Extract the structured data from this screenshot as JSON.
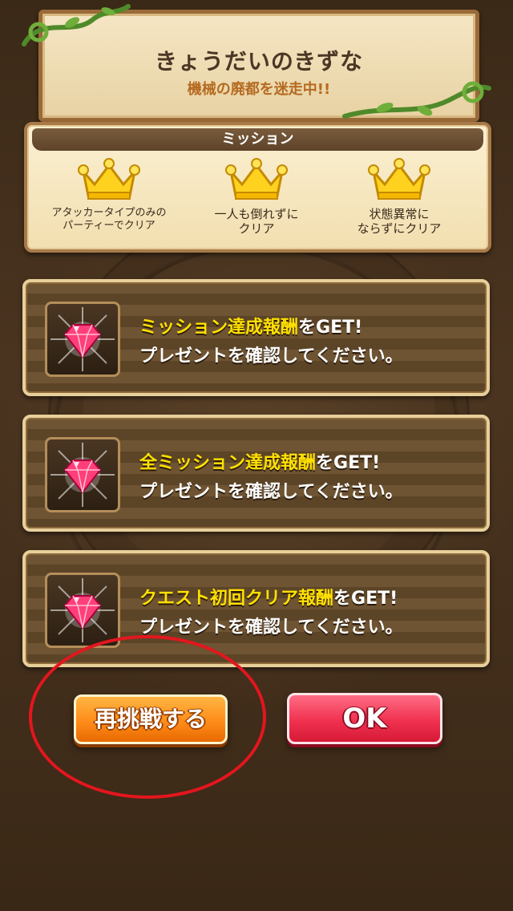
{
  "title_panel": {
    "title": "きょうだいのきずな",
    "subtitle": "機械の廃都を迷走中!!"
  },
  "mission_panel": {
    "header": "ミッション",
    "items": [
      {
        "label": "アタッカータイプのみの\nパーティーでクリア",
        "icon": "crown-icon"
      },
      {
        "label": "一人も倒れずに\nクリア",
        "icon": "crown-icon"
      },
      {
        "label": "状態異常に\nならずにクリア",
        "icon": "crown-icon"
      }
    ]
  },
  "rewards": [
    {
      "highlight": "ミッション達成報酬",
      "suffix": "をGET!",
      "line2": "プレゼントを確認してください。",
      "icon": "gem-icon"
    },
    {
      "highlight": "全ミッション達成報酬",
      "suffix": "をGET!",
      "line2": "プレゼントを確認してください。",
      "icon": "gem-icon"
    },
    {
      "highlight": "クエスト初回クリア報酬",
      "suffix": "をGET!",
      "line2": "プレゼントを確認してください。",
      "icon": "gem-icon"
    }
  ],
  "buttons": {
    "retry": "再挑戦する",
    "ok": "OK"
  },
  "colors": {
    "highlight_text": "#ffe000",
    "retry_button": "#ff8c1a",
    "ok_button": "#f0314f",
    "annotation_circle": "#e3161e"
  }
}
